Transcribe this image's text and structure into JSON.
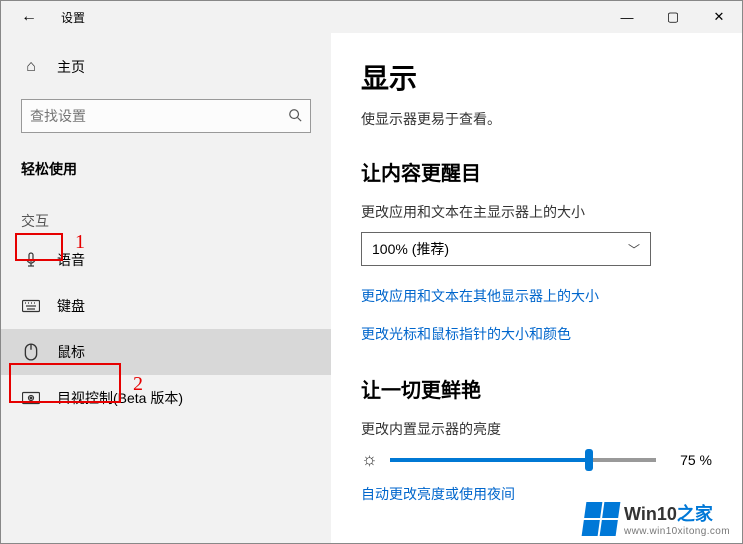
{
  "titlebar": {
    "app_name": "设置"
  },
  "sidebar": {
    "home": "主页",
    "search_placeholder": "查找设置",
    "category": "轻松使用",
    "section": "交互",
    "items": {
      "speech": "语音",
      "keyboard": "键盘",
      "mouse": "鼠标",
      "eyecontrol": "目视控制(Beta 版本)"
    }
  },
  "main": {
    "title": "显示",
    "subtitle": "使显示器更易于查看。",
    "section1": {
      "heading": "让内容更醒目",
      "scale_label": "更改应用和文本在主显示器上的大小",
      "scale_value": "100% (推荐)",
      "link_other": "更改应用和文本在其他显示器上的大小",
      "link_cursor": "更改光标和鼠标指针的大小和颜色"
    },
    "section2": {
      "heading": "让一切更鲜艳",
      "brightness_label": "更改内置显示器的亮度",
      "brightness_value": "75 %",
      "link_nightlight": "自动更改亮度或使用夜间"
    }
  },
  "annotations": {
    "one": "1",
    "two": "2"
  },
  "watermark": {
    "brand_a": "Win10",
    "brand_b": "之家",
    "url": "www.win10xitong.com"
  }
}
